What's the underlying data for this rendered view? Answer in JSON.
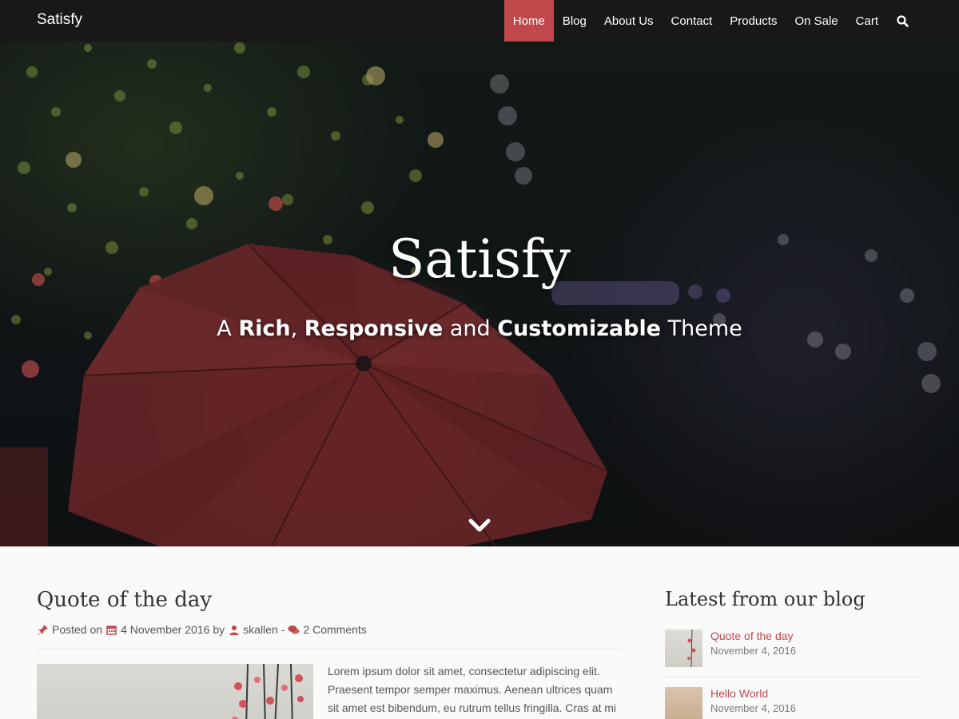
{
  "nav": {
    "brand": "Satisfy",
    "items": [
      {
        "label": "Home",
        "active": true
      },
      {
        "label": "Blog"
      },
      {
        "label": "About Us"
      },
      {
        "label": "Contact"
      },
      {
        "label": "Products"
      },
      {
        "label": "On Sale"
      },
      {
        "label": "Cart"
      }
    ],
    "search_icon": "search-icon"
  },
  "hero": {
    "title": "Satisfy",
    "subtitle_parts": [
      "A ",
      "Rich",
      ", ",
      "Responsive",
      " and ",
      "Customizable",
      " Theme"
    ],
    "scroll_icon": "chevron-down-icon"
  },
  "post": {
    "title": "Quote of the day",
    "posted_on_label": "Posted on",
    "date": "4 November 2016",
    "by_label": "by",
    "author": "skallen",
    "separator": "-",
    "comments": "2 Comments",
    "excerpt": "Lorem ipsum dolor sit amet, consectetur adipiscing elit. Praesent tempor semper maximus. Aenean ultrices quam sit amet est bibendum, eu rutrum tellus fringilla. Cras at mi"
  },
  "sidebar": {
    "title": "Latest from our blog",
    "items": [
      {
        "title": "Quote of the day",
        "date": "November 4, 2016"
      },
      {
        "title": "Hello World",
        "date": "November 4, 2016"
      }
    ]
  },
  "colors": {
    "accent": "#c0484b",
    "navbar_bg": "#181818",
    "page_bg": "#fafafa"
  }
}
